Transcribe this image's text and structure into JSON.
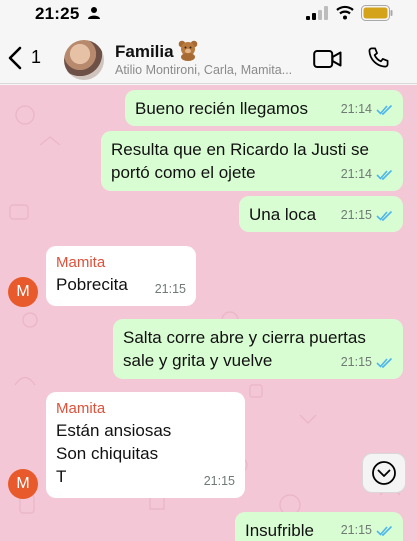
{
  "status_bar": {
    "time": "21:25"
  },
  "header": {
    "back_count": "1",
    "title": "Familia",
    "subtitle": "Atilio Montironi, Carla, Mamita..."
  },
  "messages": [
    {
      "direction": "out",
      "text": "Bueno recién llegamos",
      "time": "21:14"
    },
    {
      "direction": "out",
      "text": "Resulta que en Ricardo la Justi se portó como el ojete",
      "line1": "Resulta que en Ricardo la Justi se",
      "line2": "portó como el ojete",
      "time": "21:14"
    },
    {
      "direction": "out",
      "text": "Una loca",
      "time": "21:15"
    },
    {
      "direction": "in",
      "sender": "Mamita",
      "avatar_letter": "M",
      "text": "Pobrecita",
      "time": "21:15"
    },
    {
      "direction": "out",
      "text": "Salta corre abre y cierra puertas sale y grita y vuelve",
      "line1": "Salta corre abre y cierra puertas",
      "line2": "sale y grita y vuelve",
      "time": "21:15"
    },
    {
      "direction": "in",
      "sender": "Mamita",
      "avatar_letter": "M",
      "line1": "Están ansiosas",
      "line2": "Son chiquitas",
      "line3": "T",
      "time": "21:15"
    },
    {
      "direction": "out",
      "text": "Insufrible",
      "time": "21:15"
    }
  ],
  "colors": {
    "outgoing_bubble": "#d9fdd3",
    "incoming_bubble": "#ffffff",
    "chat_background": "#f4c7d7",
    "sender_name": "#e0513a",
    "read_ticks": "#4fb6ec"
  },
  "icons": [
    "person-icon",
    "signal-icon",
    "wifi-icon",
    "battery-icon",
    "back-chevron-icon",
    "teddy-bear-icon",
    "video-call-icon",
    "phone-icon",
    "double-check-icon",
    "scroll-down-icon"
  ]
}
